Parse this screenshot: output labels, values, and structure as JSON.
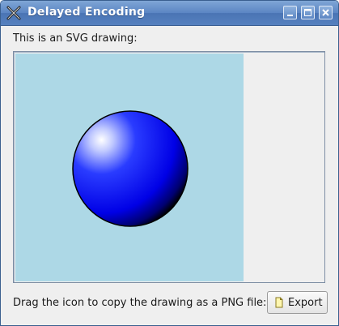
{
  "window": {
    "title": "Delayed Encoding",
    "title_icon": "x-app-icon",
    "controls": [
      "minimize-icon",
      "maximize-icon",
      "close-icon"
    ]
  },
  "main": {
    "caption": "This is an SVG drawing:",
    "drawing": {
      "background_color": "#add8e6",
      "shape": "sphere",
      "sphere_color": "#0000ff"
    }
  },
  "footer": {
    "instruction": "Drag the icon to copy the drawing as a PNG file:",
    "export_label": "Export",
    "export_icon": "file-icon"
  }
}
